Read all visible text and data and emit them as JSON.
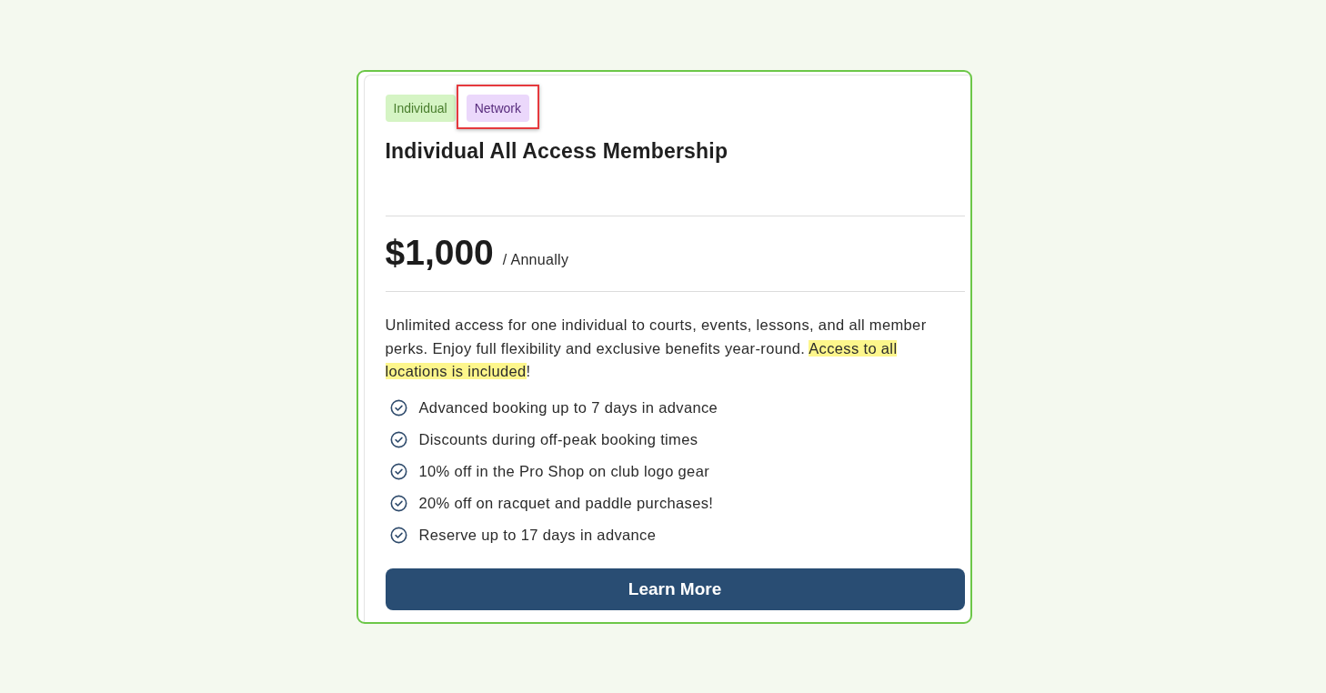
{
  "card": {
    "tags": [
      {
        "label": "Individual",
        "color": "#d5f4c4",
        "highlighted": false
      },
      {
        "label": "Network",
        "color": "#ebd8fb",
        "highlighted": true
      }
    ],
    "title": "Individual All Access Membership",
    "price": {
      "amount": "$1,000",
      "period": "/ Annually"
    },
    "description": [
      {
        "text": "Unlimited access for one individual to courts, events, lessons, and all member perks. Enjoy full flexibility and exclusive benefits year-round. ",
        "highlighted": false
      },
      {
        "text": "Access to all locations is included",
        "highlighted": true
      },
      {
        "text": "!",
        "highlighted": false
      }
    ],
    "features": [
      "Advanced booking up to 7 days in advance",
      "Discounts during off-peak booking times",
      "10% off in the Pro Shop on club logo gear",
      "20% off on racquet and paddle purchases!",
      "Reserve up to 17 days in advance"
    ],
    "button": "Learn More"
  }
}
